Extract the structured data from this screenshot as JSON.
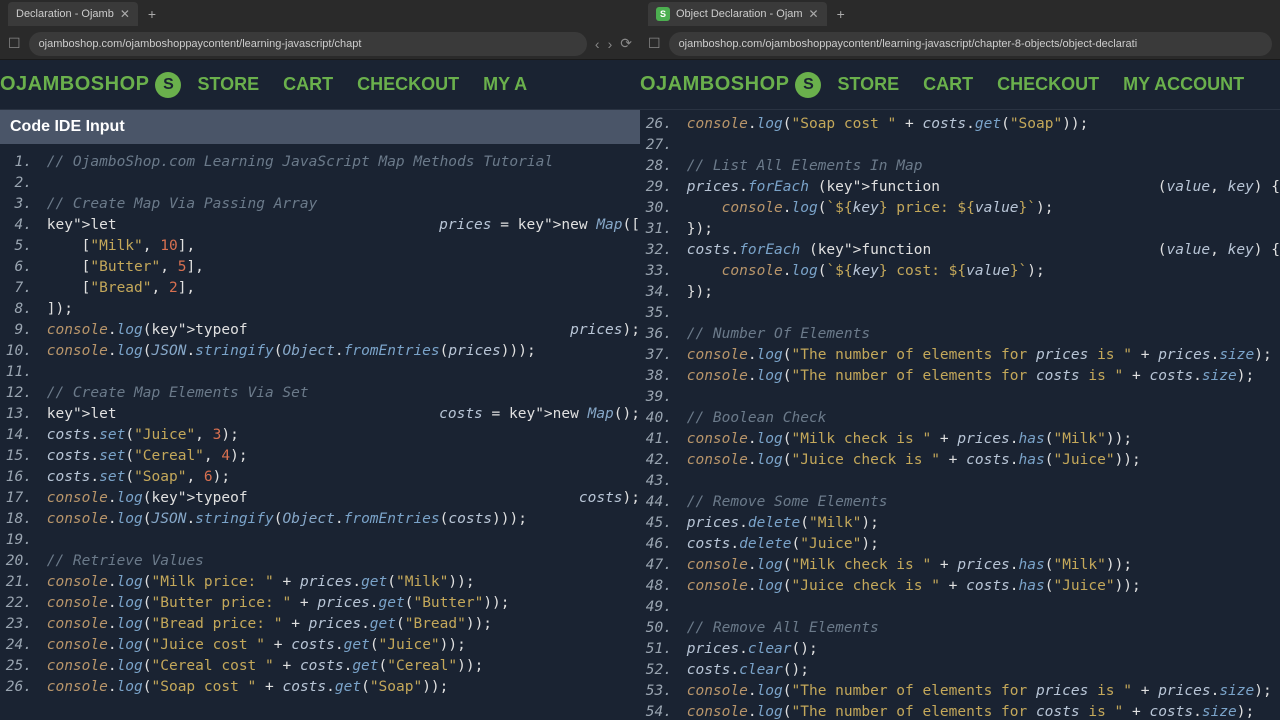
{
  "windows": [
    {
      "tab_title": "Declaration - Ojamb",
      "url": "ojamboshop.com/ojamboshoppaycontent/learning-javascript/chapt",
      "section_title": "Code IDE Input",
      "nav": [
        "STORE",
        "CART",
        "CHECKOUT",
        "MY A"
      ],
      "brand": "OJAMBOSHOP",
      "code_start": 1,
      "raw_lines": [
        {
          "n": 1,
          "t": "// OjamboShop.com Learning JavaScript Map Methods Tutorial"
        },
        {
          "n": 2,
          "t": ""
        },
        {
          "n": 3,
          "t": "// Create Map Via Passing Array"
        },
        {
          "n": 4,
          "t": "let prices = new Map(["
        },
        {
          "n": 5,
          "t": "    [\"Milk\", 10],"
        },
        {
          "n": 6,
          "t": "    [\"Butter\", 5],"
        },
        {
          "n": 7,
          "t": "    [\"Bread\", 2],"
        },
        {
          "n": 8,
          "t": "]);"
        },
        {
          "n": 9,
          "t": "console.log(typeof prices);"
        },
        {
          "n": 10,
          "t": "console.log(JSON.stringify(Object.fromEntries(prices)));"
        },
        {
          "n": 11,
          "t": ""
        },
        {
          "n": 12,
          "t": "// Create Map Elements Via Set"
        },
        {
          "n": 13,
          "t": "let costs = new Map();"
        },
        {
          "n": 14,
          "t": "costs.set(\"Juice\", 3);"
        },
        {
          "n": 15,
          "t": "costs.set(\"Cereal\", 4);"
        },
        {
          "n": 16,
          "t": "costs.set(\"Soap\", 6);"
        },
        {
          "n": 17,
          "t": "console.log(typeof costs);"
        },
        {
          "n": 18,
          "t": "console.log(JSON.stringify(Object.fromEntries(costs)));"
        },
        {
          "n": 19,
          "t": ""
        },
        {
          "n": 20,
          "t": "// Retrieve Values"
        },
        {
          "n": 21,
          "t": "console.log(\"Milk price: \" + prices.get(\"Milk\"));"
        },
        {
          "n": 22,
          "t": "console.log(\"Butter price: \" + prices.get(\"Butter\"));"
        },
        {
          "n": 23,
          "t": "console.log(\"Bread price: \" + prices.get(\"Bread\"));"
        },
        {
          "n": 24,
          "t": "console.log(\"Juice cost \" + costs.get(\"Juice\"));"
        },
        {
          "n": 25,
          "t": "console.log(\"Cereal cost \" + costs.get(\"Cereal\"));"
        },
        {
          "n": 26,
          "t": "console.log(\"Soap cost \" + costs.get(\"Soap\"));"
        }
      ]
    },
    {
      "tab_title": "Object Declaration - Ojam",
      "url": "ojamboshop.com/ojamboshoppaycontent/learning-javascript/chapter-8-objects/object-declarati",
      "nav": [
        "STORE",
        "CART",
        "CHECKOUT",
        "MY ACCOUNT"
      ],
      "brand": "OJAMBOSHOP",
      "code_start": 26,
      "raw_lines": [
        {
          "n": 26,
          "t": "console.log(\"Soap cost \" + costs.get(\"Soap\"));"
        },
        {
          "n": 27,
          "t": ""
        },
        {
          "n": 28,
          "t": "// List All Elements In Map"
        },
        {
          "n": 29,
          "t": "prices.forEach (function(value, key) {"
        },
        {
          "n": 30,
          "t": "    console.log(`${key} price: ${value}`);"
        },
        {
          "n": 31,
          "t": "});"
        },
        {
          "n": 32,
          "t": "costs.forEach (function(value, key) {"
        },
        {
          "n": 33,
          "t": "    console.log(`${key} cost: ${value}`);"
        },
        {
          "n": 34,
          "t": "});"
        },
        {
          "n": 35,
          "t": ""
        },
        {
          "n": 36,
          "t": "// Number Of Elements"
        },
        {
          "n": 37,
          "t": "console.log(\"The number of elements for prices is \" + prices.size);"
        },
        {
          "n": 38,
          "t": "console.log(\"The number of elements for costs is \" + costs.size);"
        },
        {
          "n": 39,
          "t": ""
        },
        {
          "n": 40,
          "t": "// Boolean Check"
        },
        {
          "n": 41,
          "t": "console.log(\"Milk check is \" + prices.has(\"Milk\"));"
        },
        {
          "n": 42,
          "t": "console.log(\"Juice check is \" + costs.has(\"Juice\"));"
        },
        {
          "n": 43,
          "t": ""
        },
        {
          "n": 44,
          "t": "// Remove Some Elements"
        },
        {
          "n": 45,
          "t": "prices.delete(\"Milk\");"
        },
        {
          "n": 46,
          "t": "costs.delete(\"Juice\");"
        },
        {
          "n": 47,
          "t": "console.log(\"Milk check is \" + prices.has(\"Milk\"));"
        },
        {
          "n": 48,
          "t": "console.log(\"Juice check is \" + costs.has(\"Juice\"));"
        },
        {
          "n": 49,
          "t": ""
        },
        {
          "n": 50,
          "t": "// Remove All Elements"
        },
        {
          "n": 51,
          "t": "prices.clear();"
        },
        {
          "n": 52,
          "t": "costs.clear();"
        },
        {
          "n": 53,
          "t": "console.log(\"The number of elements for prices is \" + prices.size);"
        },
        {
          "n": 54,
          "t": "console.log(\"The number of elements for costs is \" + costs.size);"
        }
      ]
    }
  ]
}
